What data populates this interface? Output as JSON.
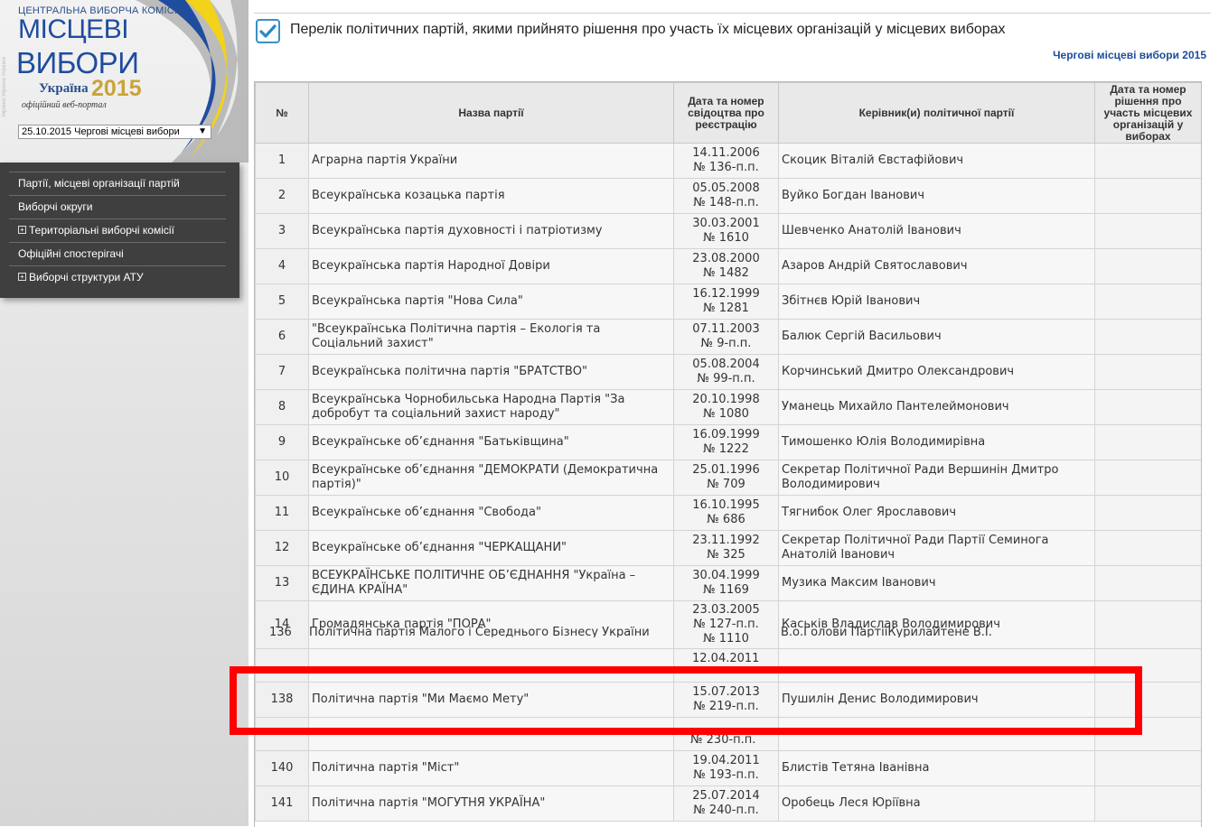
{
  "sidebar": {
    "logo": {
      "org": "ЦЕНТРАЛЬНА ВИБОРЧА КОМІСІЯ",
      "line1": "МІСЦЕВІ",
      "line2": "ВИБОРИ",
      "country": "Україна",
      "year": "2015",
      "subtitle": "офіційний веб-портал"
    },
    "election_select": "25.10.2015 Чергові місцеві вибори",
    "menu": [
      {
        "label": "Партії, місцеві організації партій",
        "expandable": false
      },
      {
        "label": "Виборчі округи",
        "expandable": false
      },
      {
        "label": "Територіальні виборчі комісії",
        "expandable": true
      },
      {
        "label": "Офіційні спостерігачі",
        "expandable": false
      },
      {
        "label": "Виборчі структури АТУ",
        "expandable": true
      }
    ],
    "colors": {
      "menu_bg": "#3f3f3f",
      "logo_blue": "#1f4c9e",
      "logo_gold": "#c9a436"
    }
  },
  "header": {
    "title": "Перелік політичних партій, якими прийнято рішення про участь їх місцевих організацій у місцевих виборах",
    "election_link": "Чергові місцеві вибори 2015",
    "icon": "checkbox-checked-icon"
  },
  "table": {
    "columns": [
      "№",
      "Назва партії",
      "Дата та номер свідоцтва про реєстрацію",
      "Керівник(и) політичної партії",
      "Дата та номер рішення про участь місцевих організацій у виборах"
    ],
    "rows": [
      {
        "num": "1",
        "name": "Аграрна партія України",
        "date": "14.11.2006",
        "cert": "№ 136-п.п.",
        "leader": "Скоцик Віталій Євстафійович",
        "decision": ""
      },
      {
        "num": "2",
        "name": "Всеукраїнська козацька партія",
        "date": "05.05.2008",
        "cert": "№ 148-п.п.",
        "leader": "Вуйко Богдан Іванович",
        "decision": ""
      },
      {
        "num": "3",
        "name": "Всеукраїнська партія духовності і патріотизму",
        "date": "30.03.2001",
        "cert": "№ 1610",
        "leader": "Шевченко Анатолій Іванович",
        "decision": ""
      },
      {
        "num": "4",
        "name": "Всеукраїнська партія Народної Довіри",
        "date": "23.08.2000",
        "cert": "№ 1482",
        "leader": "Азаров Андрій Святославович",
        "decision": ""
      },
      {
        "num": "5",
        "name": "Всеукраїнська партія \"Нова Сила\"",
        "date": "16.12.1999",
        "cert": "№ 1281",
        "leader": "Збітнєв Юрій Іванович",
        "decision": ""
      },
      {
        "num": "6",
        "name": "\"Всеукраїнська Політична партія – Екологія та Соціальний захист\"",
        "date": "07.11.2003",
        "cert": "№ 9-п.п.",
        "leader": "Балюк Сергій Васильович",
        "decision": ""
      },
      {
        "num": "7",
        "name": "Всеукраїнська політична партія \"БРАТСТВО\"",
        "date": "05.08.2004",
        "cert": "№ 99-п.п.",
        "leader": "Корчинський Дмитро Олександрович",
        "decision": ""
      },
      {
        "num": "8",
        "name": "Всеукраїнська Чорнобильська Народна Партія \"За добробут та соціальний захист народу\"",
        "date": "20.10.1998",
        "cert": "№ 1080",
        "leader": "Уманець Михайло Пантелеймонович",
        "decision": ""
      },
      {
        "num": "9",
        "name": "Всеукраїнське об’єднання \"Батьківщина\"",
        "date": "16.09.1999",
        "cert": "№ 1222",
        "leader": "Тимошенко Юлія Володимирівна",
        "decision": ""
      },
      {
        "num": "10",
        "name": "Всеукраїнське об’єднання \"ДЕМОКРАТИ (Демократична партія)\"",
        "date": "25.01.1996",
        "cert": "№ 709",
        "leader": "Секретар Політичної Ради Вершинін Дмитро Володимирович",
        "decision": ""
      },
      {
        "num": "11",
        "name": "Всеукраїнське об’єднання \"Свобода\"",
        "date": "16.10.1995",
        "cert": "№ 686",
        "leader": "Тягнибок Олег Ярославович",
        "decision": ""
      },
      {
        "num": "12",
        "name": "Всеукраїнське об’єднання \"ЧЕРКАЩАНИ\"",
        "date": "23.11.1992",
        "cert": "№ 325",
        "leader": "Секретар Політичної Ради Партії Семинога Анатолій Іванович",
        "decision": ""
      },
      {
        "num": "13",
        "name": "ВСЕУКРАЇНСЬКЕ ПОЛІТИЧНЕ ОБ’ЄДНАННЯ \"Україна – ЄДИНА КРАЇНА\"",
        "date": "30.04.1999",
        "cert": "№ 1169",
        "leader": "Музика Максим Іванович",
        "decision": ""
      },
      {
        "num": "14",
        "name": "Громадянська партія \"ПОРА\"",
        "date": "23.03.2005",
        "cert": "№ 127-п.п.",
        "leader": "Каськів Владислав Володимирович",
        "decision": ""
      }
    ],
    "extra_line_14": "№ 1110",
    "ghost_136": {
      "num": "136",
      "name": "Політична партія Малого і Середнього Бізнесу України",
      "leader": "В.о.Голови ПартіїКурилайтене В.І."
    },
    "ghost_137_date": "12.04.2011",
    "highlighted_row": {
      "num": "138",
      "name": "Політична партія \"Ми Маємо Мету\"",
      "date": "15.07.2013",
      "cert": "№ 219-п.п.",
      "leader": "Пушилін Денис Володимирович",
      "decision": ""
    },
    "ghost_139_cert": "№ 230-п.п.",
    "tail_rows": [
      {
        "num": "140",
        "name": "Політична партія \"Міст\"",
        "date": "19.04.2011",
        "cert": "№ 193-п.п.",
        "leader": "Блистів Тетяна Іванівна",
        "decision": ""
      },
      {
        "num": "141",
        "name": "Політична партія \"МОГУТНЯ УКРАЇНА\"",
        "date": "25.07.2014",
        "cert": "№ 240-п.п.",
        "leader": "Оробець Леся Юріївна",
        "decision": ""
      }
    ],
    "highlight_color": "#ff0000"
  }
}
